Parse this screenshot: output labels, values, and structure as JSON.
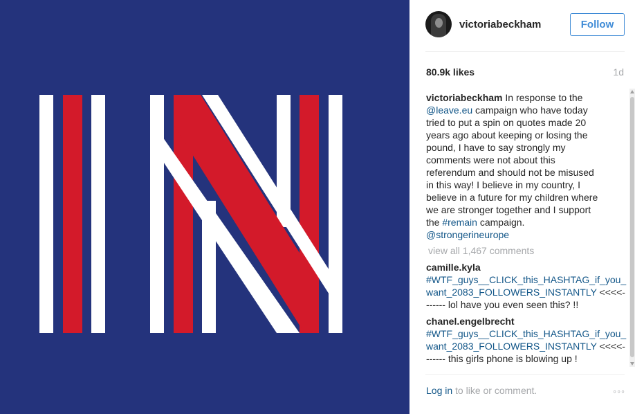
{
  "colors": {
    "photo_background": "#24337c",
    "stripe_white": "#ffffff",
    "stripe_red": "#d31a2a",
    "link": "#125688",
    "follow_blue": "#3f8bd6",
    "muted": "#a5a7aa"
  },
  "post": {
    "image_subject": "IN logo with white and red stripes",
    "header": {
      "avatar_icon": "profile-avatar",
      "username": "victoriabeckham",
      "follow_label": "Follow"
    },
    "likes": "80.9k likes",
    "time": "1d",
    "caption": {
      "author": "victoriabeckham",
      "lines": [
        [
          {
            "t": " In response to the",
            "link": false
          }
        ],
        [
          {
            "t": "@leave.eu",
            "link": true
          },
          {
            "t": " campaign who have today",
            "link": false
          }
        ],
        [
          {
            "t": "tried to put a spin on quotes made 20",
            "link": false
          }
        ],
        [
          {
            "t": "years ago about keeping or losing the",
            "link": false
          }
        ],
        [
          {
            "t": "pound, I have to say strongly my",
            "link": false
          }
        ],
        [
          {
            "t": "comments were not about this",
            "link": false
          }
        ],
        [
          {
            "t": "referendum and should not be misused",
            "link": false
          }
        ],
        [
          {
            "t": "in this way! I believe in my country, I",
            "link": false
          }
        ],
        [
          {
            "t": "believe in a future for my children where",
            "link": false
          }
        ],
        [
          {
            "t": "we are stronger together and I support",
            "link": false
          }
        ],
        [
          {
            "t": "the ",
            "link": false
          },
          {
            "t": "#remain",
            "link": true
          },
          {
            "t": " campaign.",
            "link": false
          }
        ],
        [
          {
            "t": "@strongerineurope",
            "link": true
          }
        ]
      ]
    },
    "view_all_comments": "view all 1,467 comments",
    "comments": [
      {
        "author": "camille.kyla",
        "hashtag": "#WTF_guys__CLICK_this_HASHTAG_if_you_want_2083_FOLLOWERS_INSTANTLY",
        "text": " <<<<------- lol have you even seen this? !!"
      },
      {
        "author": "chanel.engelbrecht",
        "hashtag": "#WTF_guys__CLICK_this_HASHTAG_if_you_want_2083_FOLLOWERS_INSTANTLY",
        "text": " <<<<------- this girls phone is blowing up !"
      }
    ],
    "footer": {
      "login_label": "Log in",
      "suffix": " to like or comment.",
      "more_icon": "ellipsis-icon",
      "more_text": "◦◦◦"
    }
  }
}
